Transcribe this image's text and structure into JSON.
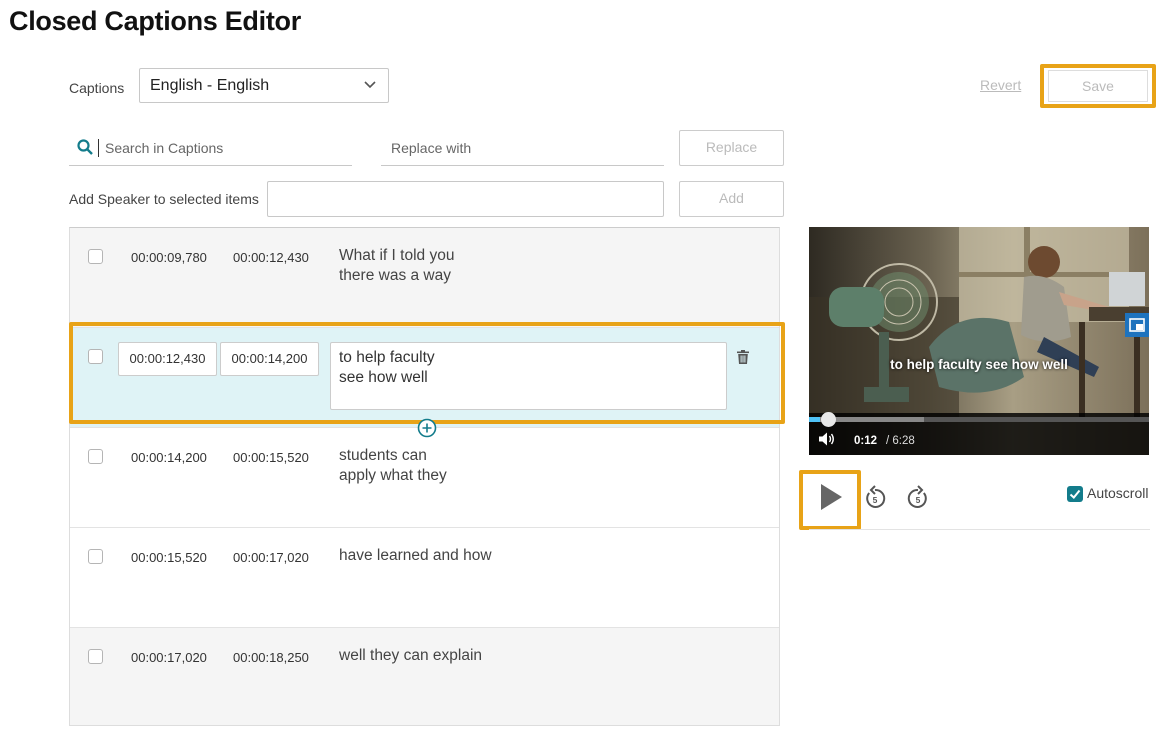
{
  "page": {
    "title": "Closed Captions Editor"
  },
  "toolbar": {
    "captions_label": "Captions",
    "language_selected": "English - English",
    "revert_label": "Revert",
    "save_label": "Save"
  },
  "search": {
    "placeholder": "Search in Captions",
    "replace_placeholder": "Replace with",
    "replace_label": "Replace"
  },
  "speaker": {
    "label": "Add Speaker to selected items",
    "add_label": "Add"
  },
  "captions": [
    {
      "start": "00:00:09,780",
      "end": "00:00:12,430",
      "text": "What if I told you\nthere was a way"
    },
    {
      "start": "00:00:12,430",
      "end": "00:00:14,200",
      "text": "to help faculty\nsee how well"
    },
    {
      "start": "00:00:14,200",
      "end": "00:00:15,520",
      "text": "students can\napply what they"
    },
    {
      "start": "00:00:15,520",
      "end": "00:00:17,020",
      "text": "have learned and how"
    },
    {
      "start": "00:00:17,020",
      "end": "00:00:18,250",
      "text": "well they can explain"
    }
  ],
  "selected_caption_index": 1,
  "player": {
    "subtitle": "to help faculty see how well",
    "current_time": "0:12",
    "duration": "/ 6:28",
    "progress_fraction": 0.031
  },
  "controls": {
    "rewind_seconds": "5",
    "forward_seconds": "5",
    "autoscroll_label": "Autoscroll",
    "autoscroll_checked": true
  },
  "colors": {
    "highlight": "#e8a317",
    "accent": "#137c8b",
    "selected_row": "#dff3f6"
  }
}
